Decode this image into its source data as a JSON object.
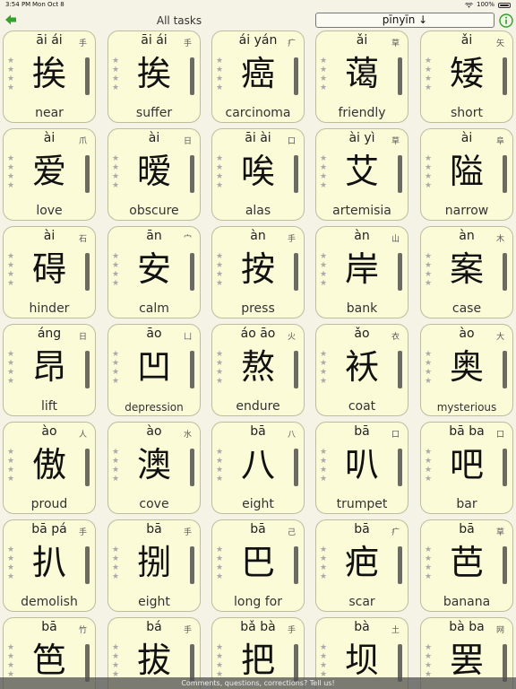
{
  "status_bar": {
    "time": "3:54 PM",
    "date": "Mon Oct 8",
    "battery": "100%"
  },
  "toolbar": {
    "title": "All tasks",
    "sort_label": "pīnyīn ↓"
  },
  "colors": {
    "accent": "#2fa32a",
    "card_bg": "#fbfbd8",
    "page_bg": "#f4f3e6"
  },
  "cards": [
    {
      "pinyin": "āi ái",
      "radical": "手",
      "hanzi": "挨",
      "english": "near"
    },
    {
      "pinyin": "āi ái",
      "radical": "手",
      "hanzi": "挨",
      "english": "suffer"
    },
    {
      "pinyin": "ái yán",
      "radical": "疒",
      "hanzi": "癌",
      "english": "carcinoma"
    },
    {
      "pinyin": "ǎi",
      "radical": "草",
      "hanzi": "蔼",
      "english": "friendly"
    },
    {
      "pinyin": "ǎi",
      "radical": "矢",
      "hanzi": "矮",
      "english": "short"
    },
    {
      "pinyin": "ài",
      "radical": "爪",
      "hanzi": "爱",
      "english": "love"
    },
    {
      "pinyin": "ài",
      "radical": "日",
      "hanzi": "暧",
      "english": "obscure"
    },
    {
      "pinyin": "āi ài",
      "radical": "口",
      "hanzi": "唉",
      "english": "alas"
    },
    {
      "pinyin": "ài yì",
      "radical": "草",
      "hanzi": "艾",
      "english": "artemisia"
    },
    {
      "pinyin": "ài",
      "radical": "阜",
      "hanzi": "隘",
      "english": "narrow"
    },
    {
      "pinyin": "ài",
      "radical": "石",
      "hanzi": "碍",
      "english": "hinder"
    },
    {
      "pinyin": "ān",
      "radical": "宀",
      "hanzi": "安",
      "english": "calm"
    },
    {
      "pinyin": "àn",
      "radical": "手",
      "hanzi": "按",
      "english": "press"
    },
    {
      "pinyin": "àn",
      "radical": "山",
      "hanzi": "岸",
      "english": "bank"
    },
    {
      "pinyin": "àn",
      "radical": "木",
      "hanzi": "案",
      "english": "case"
    },
    {
      "pinyin": "áng",
      "radical": "日",
      "hanzi": "昂",
      "english": "lift"
    },
    {
      "pinyin": "āo",
      "radical": "凵",
      "hanzi": "凹",
      "english": "depression"
    },
    {
      "pinyin": "áo āo",
      "radical": "火",
      "hanzi": "熬",
      "english": "endure"
    },
    {
      "pinyin": "ǎo",
      "radical": "衣",
      "hanzi": "袄",
      "english": "coat"
    },
    {
      "pinyin": "ào",
      "radical": "大",
      "hanzi": "奥",
      "english": "mysterious"
    },
    {
      "pinyin": "ào",
      "radical": "人",
      "hanzi": "傲",
      "english": "proud"
    },
    {
      "pinyin": "ào",
      "radical": "水",
      "hanzi": "澳",
      "english": "cove"
    },
    {
      "pinyin": "bā",
      "radical": "八",
      "hanzi": "八",
      "english": "eight"
    },
    {
      "pinyin": "bā",
      "radical": "口",
      "hanzi": "叭",
      "english": "trumpet"
    },
    {
      "pinyin": "bā ba",
      "radical": "口",
      "hanzi": "吧",
      "english": "bar"
    },
    {
      "pinyin": "bā pá",
      "radical": "手",
      "hanzi": "扒",
      "english": "demolish"
    },
    {
      "pinyin": "bā",
      "radical": "手",
      "hanzi": "捌",
      "english": "eight"
    },
    {
      "pinyin": "bā",
      "radical": "己",
      "hanzi": "巴",
      "english": "long for"
    },
    {
      "pinyin": "bā",
      "radical": "疒",
      "hanzi": "疤",
      "english": "scar"
    },
    {
      "pinyin": "bā",
      "radical": "草",
      "hanzi": "芭",
      "english": "banana"
    },
    {
      "pinyin": "bā",
      "radical": "竹",
      "hanzi": "笆",
      "english": ""
    },
    {
      "pinyin": "bá",
      "radical": "手",
      "hanzi": "拔",
      "english": ""
    },
    {
      "pinyin": "bǎ bà",
      "radical": "手",
      "hanzi": "把",
      "english": ""
    },
    {
      "pinyin": "bà",
      "radical": "土",
      "hanzi": "坝",
      "english": ""
    },
    {
      "pinyin": "bà ba",
      "radical": "网",
      "hanzi": "罢",
      "english": ""
    }
  ],
  "footer": {
    "text": "Comments, questions, corrections? Tell us!"
  }
}
